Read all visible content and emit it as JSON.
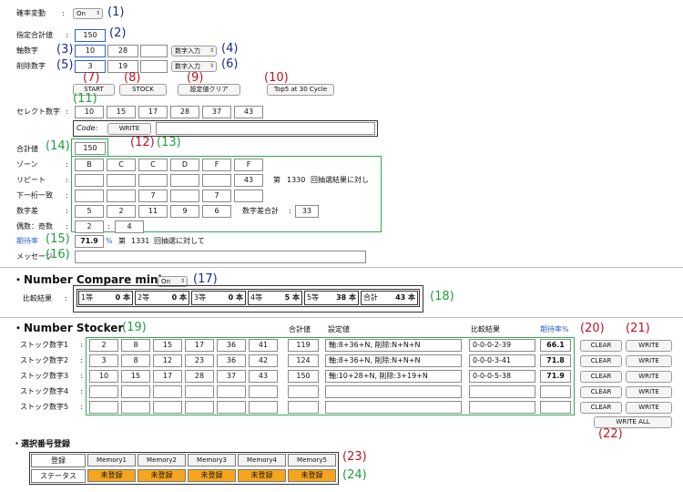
{
  "section1": {
    "label_kakuritsu": "確率変動",
    "select_kakuritsu": "On",
    "label_goukei_target": "指定合計値",
    "goukei_target_value": "150",
    "label_jiku": "軸数字",
    "jiku_values": [
      "10",
      "28",
      ""
    ],
    "jiku_mode": "数字入力",
    "label_sakujo": "削除数字",
    "sakujo_values": [
      "3",
      "19",
      ""
    ],
    "sakujo_mode": "数字入力",
    "btn_start": "START",
    "btn_stock": "STOCK",
    "btn_clear_settings": "設定値クリア",
    "btn_top5": "Top5 at 30 Cycle",
    "label_select": "セレクト数字",
    "select_numbers": [
      "10",
      "15",
      "17",
      "28",
      "37",
      "43"
    ],
    "code_label": "Code:",
    "btn_write": "WRITE",
    "label_goukei": "合計値",
    "goukei_value": "150",
    "label_zone": "ゾーン",
    "zone": [
      "B",
      "C",
      "C",
      "D",
      "F",
      "F"
    ],
    "label_repeat": "リピート",
    "repeat": [
      "",
      "",
      "",
      "",
      "",
      "43"
    ],
    "repeat_round_prefix": "第",
    "repeat_round": "1330",
    "repeat_round_suffix": "回抽選結果に対し",
    "label_shimo": "下一桁一致",
    "shimo": [
      "",
      "",
      "7",
      "",
      "7",
      ""
    ],
    "label_sa": "数字差",
    "sa": [
      "5",
      "2",
      "11",
      "9",
      "6"
    ],
    "label_sa_total": "数字差合計",
    "sa_total": "33",
    "label_guki": "偶数：奇数",
    "guki_even": "2",
    "guki_sep": ":",
    "guki_odd": "4",
    "label_kitai": "期待率",
    "kitai_value": "71.9",
    "kitai_unit": "%",
    "kitai_round_prefix": "第",
    "kitai_round": "1331",
    "kitai_round_suffix": "回抽選に対して",
    "label_message": "メッセージ",
    "message_value": ""
  },
  "compare": {
    "title": "・Number Compare mini",
    "toggle": "On",
    "label": "比較結果",
    "cells": [
      {
        "name": "1等",
        "value": "0 本"
      },
      {
        "name": "2等",
        "value": "0 本"
      },
      {
        "name": "3等",
        "value": "0 本"
      },
      {
        "name": "4等",
        "value": "5 本"
      },
      {
        "name": "5等",
        "value": "38 本"
      },
      {
        "name": "合計",
        "value": "43 本"
      }
    ]
  },
  "stocker": {
    "title": "・Number Stocker",
    "col_goukei": "合計値",
    "col_settei": "設定値",
    "col_hikaku": "比較結果",
    "col_kitai": "期待率%",
    "rows": [
      {
        "label": "ストック数字1",
        "nums": [
          "2",
          "8",
          "15",
          "17",
          "36",
          "41"
        ],
        "total": "119",
        "setting": "軸:8+36+N, 削除:N+N+N",
        "result": "0-0-0-2-39",
        "rate": "66.1",
        "clear": "CLEAR",
        "write": "WRITE"
      },
      {
        "label": "ストック数字2",
        "nums": [
          "3",
          "8",
          "12",
          "23",
          "36",
          "42"
        ],
        "total": "124",
        "setting": "軸:8+36+N, 削除:N+N+N",
        "result": "0-0-0-3-41",
        "rate": "71.8",
        "clear": "CLEAR",
        "write": "WRITE"
      },
      {
        "label": "ストック数字3",
        "nums": [
          "10",
          "15",
          "17",
          "28",
          "37",
          "43"
        ],
        "total": "150",
        "setting": "軸:10+28+N, 削除:3+19+N",
        "result": "0-0-0-5-38",
        "rate": "71.9",
        "clear": "CLEAR",
        "write": "WRITE"
      },
      {
        "label": "ストック数字4",
        "nums": [
          "",
          "",
          "",
          "",
          "",
          ""
        ],
        "total": "",
        "setting": "",
        "result": "",
        "rate": "",
        "clear": "CLEAR",
        "write": "WRITE"
      },
      {
        "label": "ストック数字5",
        "nums": [
          "",
          "",
          "",
          "",
          "",
          ""
        ],
        "total": "",
        "setting": "",
        "result": "",
        "rate": "",
        "clear": "CLEAR",
        "write": "WRITE"
      }
    ],
    "write_all": "WRITE ALL"
  },
  "memory": {
    "title": "・選択番号登録",
    "row1_label": "登録",
    "row2_label": "ステータス",
    "slots": [
      "Memory1",
      "Memory2",
      "Memory3",
      "Memory4",
      "Memory5"
    ],
    "status": [
      "未登録",
      "未登録",
      "未登録",
      "未登録",
      "未登録"
    ]
  },
  "annotations": [
    "(1)",
    "(2)",
    "(3)",
    "(4)",
    "(5)",
    "(6)",
    "(7)",
    "(8)",
    "(9)",
    "(10)",
    "(11)",
    "(12)",
    "(13)",
    "(14)",
    "(15)",
    "(16)",
    "(17)",
    "(18)",
    "(19)",
    "(20)",
    "(21)",
    "(22)",
    "(23)",
    "(24)"
  ],
  "colors": {
    "annotation_blue": "#1b2a8a",
    "annotation_red": "#c1121f",
    "annotation_green": "#1f9e3f",
    "frame_green": "#2fab55",
    "status_orange": "#f7a51c"
  }
}
